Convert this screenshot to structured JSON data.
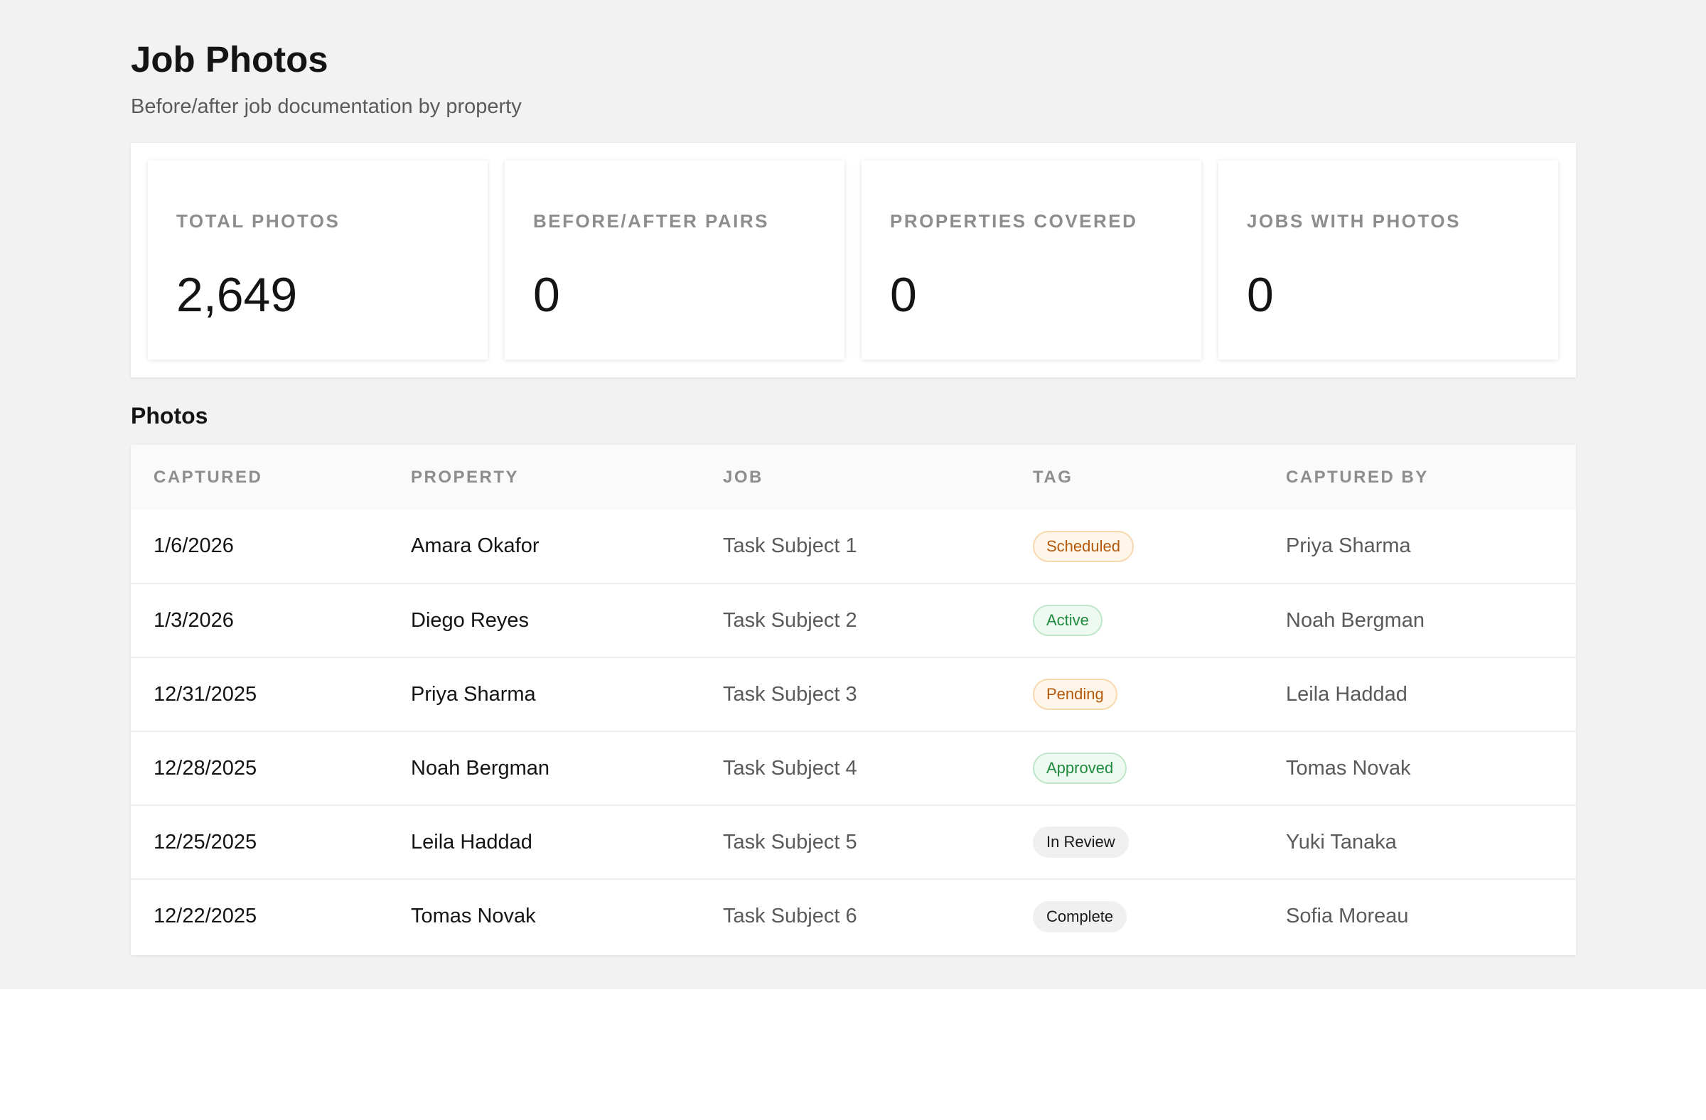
{
  "header": {
    "title": "Job Photos",
    "subtitle": "Before/after job documentation by property"
  },
  "stats": [
    {
      "label": "TOTAL PHOTOS",
      "value": "2,649"
    },
    {
      "label": "BEFORE/AFTER PAIRS",
      "value": "0"
    },
    {
      "label": "PROPERTIES COVERED",
      "value": "0"
    },
    {
      "label": "JOBS WITH PHOTOS",
      "value": "0"
    }
  ],
  "photos": {
    "section_title": "Photos",
    "columns": [
      "CAPTURED",
      "PROPERTY",
      "JOB",
      "TAG",
      "CAPTURED BY"
    ],
    "rows": [
      {
        "captured": "1/6/2026",
        "property": "Amara Okafor",
        "job": "Task Subject 1",
        "tag": "Scheduled",
        "captured_by": "Priya Sharma"
      },
      {
        "captured": "1/3/2026",
        "property": "Diego Reyes",
        "job": "Task Subject 2",
        "tag": "Active",
        "captured_by": "Noah Bergman"
      },
      {
        "captured": "12/31/2025",
        "property": "Priya Sharma",
        "job": "Task Subject 3",
        "tag": "Pending",
        "captured_by": "Leila Haddad"
      },
      {
        "captured": "12/28/2025",
        "property": "Noah Bergman",
        "job": "Task Subject 4",
        "tag": "Approved",
        "captured_by": "Tomas Novak"
      },
      {
        "captured": "12/25/2025",
        "property": "Leila Haddad",
        "job": "Task Subject 5",
        "tag": "In Review",
        "captured_by": "Yuki Tanaka"
      },
      {
        "captured": "12/22/2025",
        "property": "Tomas Novak",
        "job": "Task Subject 6",
        "tag": "Complete",
        "captured_by": "Sofia Moreau"
      }
    ]
  },
  "colors": {
    "page_background": "#f2f2f2",
    "tag_warning_text": "#b3590d",
    "tag_success_text": "#1f8a3e",
    "tag_neutral_bg": "#f0f0f0"
  }
}
